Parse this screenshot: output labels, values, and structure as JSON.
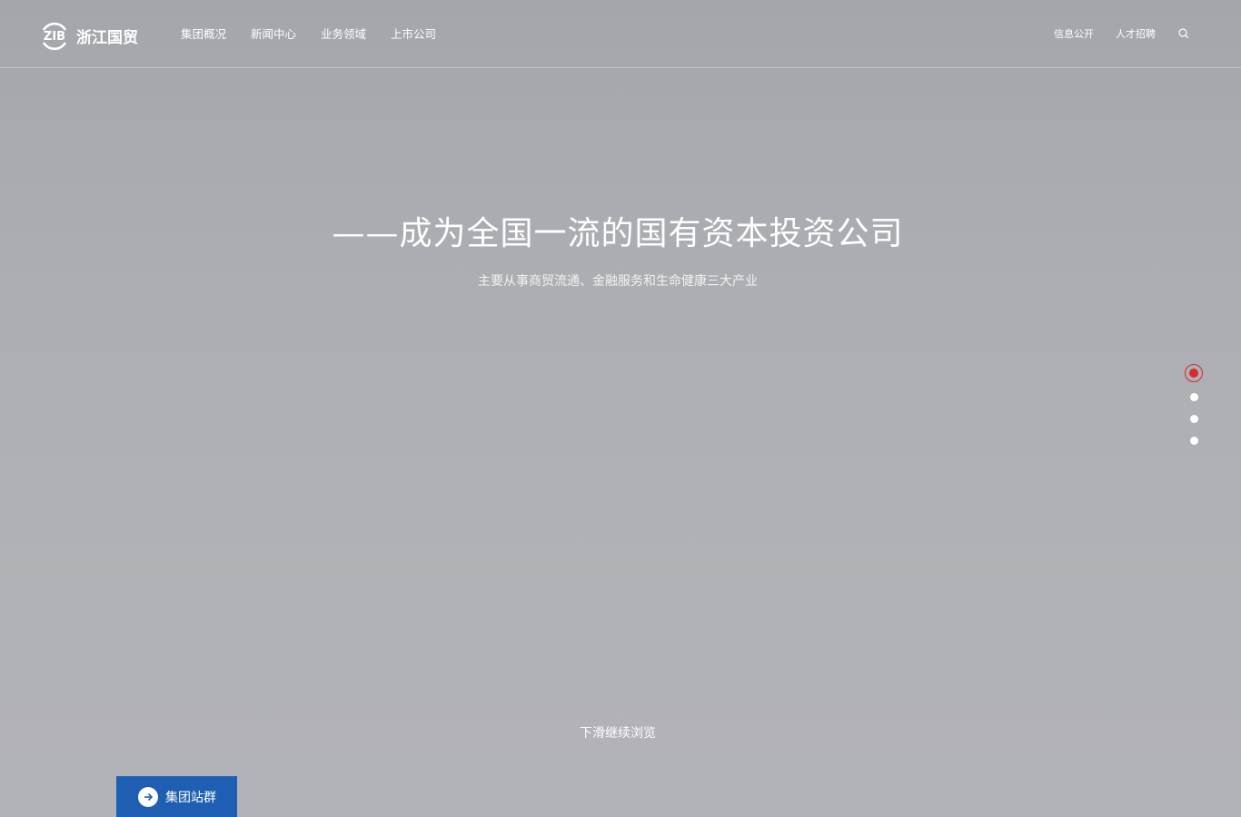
{
  "header": {
    "logo": {
      "mark": "ZIB",
      "text": "浙江国贸"
    },
    "nav_main": [
      "集团概况",
      "新闻中心",
      "业务领域",
      "上市公司"
    ],
    "nav_right": [
      "信息公开",
      "人才招聘"
    ],
    "search_icon": "search-icon"
  },
  "hero": {
    "title": "——成为全国一流的国有资本投资公司",
    "subtitle": "主要从事商贸流通、金融服务和生命健康三大产业"
  },
  "pager": {
    "count": 4,
    "active_index": 0,
    "active_color": "#d62b2b"
  },
  "scroll_hint": "下滑继续浏览",
  "site_group": {
    "label": "集团站群",
    "icon": "arrow-right-icon",
    "color": "#1f5fb3"
  }
}
